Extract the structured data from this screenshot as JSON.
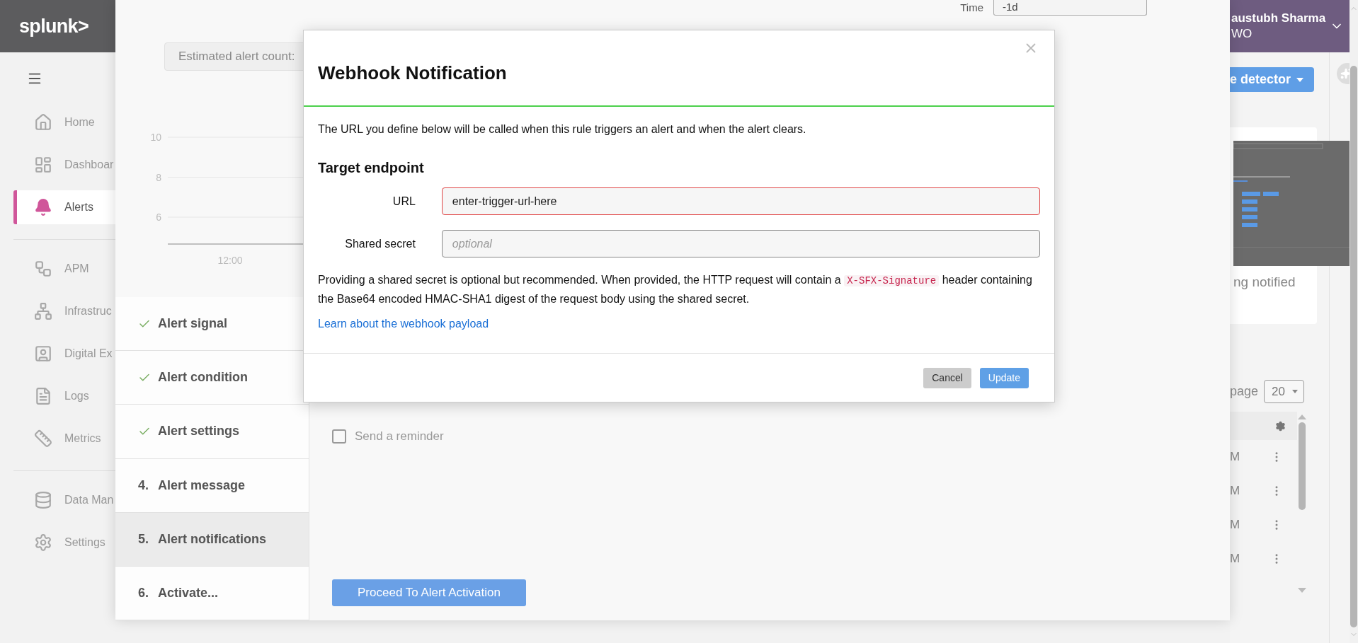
{
  "top_bar": {
    "logo": "splunk>",
    "user": {
      "name": "austubh Sharma",
      "org": "WO"
    }
  },
  "sidebar": {
    "groups": [
      {
        "items": [
          {
            "kind": "home",
            "label": "Home",
            "selected": false
          },
          {
            "kind": "dashboards",
            "label": "Dashboar",
            "selected": false
          },
          {
            "kind": "alerts",
            "label": "Alerts",
            "selected": true
          }
        ]
      },
      {
        "items": [
          {
            "kind": "apm",
            "label": "APM",
            "selected": false
          },
          {
            "kind": "infrastructure",
            "label": "Infrastruc",
            "selected": false
          },
          {
            "kind": "digital",
            "label": "Digital Ex",
            "selected": false
          },
          {
            "kind": "logs",
            "label": "Logs",
            "selected": false
          },
          {
            "kind": "metrics",
            "label": "Metrics",
            "selected": false
          }
        ]
      },
      {
        "items": [
          {
            "kind": "data",
            "label": "Data Man",
            "selected": false
          },
          {
            "kind": "settings",
            "label": "Settings",
            "selected": false
          }
        ]
      }
    ]
  },
  "right_panel": {
    "action_button": "e detector",
    "caption": "ng notified",
    "per_page_label": "page",
    "per_page": "20",
    "rows": [
      {
        "cell": "M"
      },
      {
        "cell": "M"
      },
      {
        "cell": "M"
      },
      {
        "cell": "M"
      }
    ]
  },
  "detector_dialog": {
    "time_label": "Time",
    "time_value": "-1d",
    "estimate_label": "Estimated alert count:",
    "y_ticks": [
      "10",
      "8",
      "6"
    ],
    "x_ticks": [
      "12:00"
    ],
    "steps": [
      {
        "label": "Alert signal",
        "done": true,
        "selected": false
      },
      {
        "label": "Alert condition",
        "done": true,
        "selected": false
      },
      {
        "label": "Alert settings",
        "done": true,
        "selected": false
      },
      {
        "number": "4.",
        "label": "Alert message",
        "done": false,
        "selected": false
      },
      {
        "number": "5.",
        "label": "Alert notifications",
        "done": false,
        "selected": true
      },
      {
        "number": "6.",
        "label": "Activate...",
        "done": false,
        "selected": false
      }
    ],
    "reminder": {
      "label": "Send a reminder",
      "checked": false
    },
    "proceed_button": "Proceed To Alert Activation"
  },
  "modal": {
    "title": "Webhook Notification",
    "intro": "The URL you define below will be called when this rule triggers an alert and when the alert clears.",
    "section": "Target endpoint",
    "fields": [
      {
        "label": "URL",
        "value": "enter-trigger-url-here",
        "invalid": true
      },
      {
        "label": "Shared secret",
        "placeholder": "optional",
        "invalid": false
      }
    ],
    "note_before": "Providing a shared secret is optional but recommended. When provided, the HTTP request will contain a ",
    "note_code": "X-SFX-Signature",
    "note_after": " header containing the Base64 encoded HMAC-SHA1 digest of the request body using the shared secret.",
    "link": "Learn about the webhook payload",
    "cancel_button": "Cancel",
    "update_button": "Update"
  }
}
